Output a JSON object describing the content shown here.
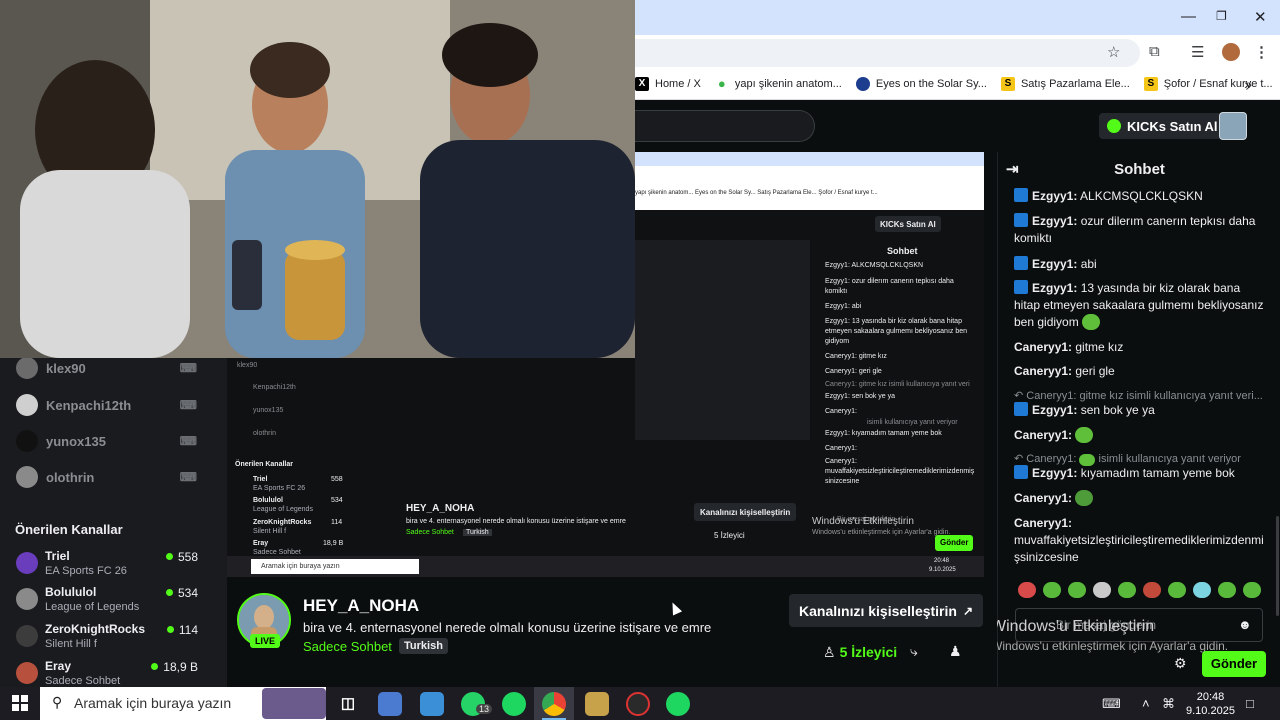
{
  "browser": {
    "bookmarks": [
      {
        "label": "Home / X",
        "icon": "x-icon",
        "color": "#000000"
      },
      {
        "label": "yapı şikenin anatom...",
        "icon": "leaf-icon",
        "color": "#3bb44a"
      },
      {
        "label": "Eyes on the Solar Sy...",
        "icon": "nasa-icon",
        "color": "#1d3d8f"
      },
      {
        "label": "Satış Pazarlama Ele...",
        "icon": "s-icon",
        "color": "#f5c518"
      },
      {
        "label": "Şofor / Esnaf kurye t...",
        "icon": "s-icon",
        "color": "#f5c518"
      }
    ],
    "more_chevron": "»"
  },
  "kick": {
    "kicks_button": "KICKs Satın Al",
    "accent": "#53fc18"
  },
  "sidebar": {
    "followed": [
      {
        "name": "klex90"
      },
      {
        "name": "Kenpachi12th"
      },
      {
        "name": "yunox135"
      },
      {
        "name": "olothrin"
      }
    ],
    "recommended_title": "Önerilen Kanallar",
    "recommended": [
      {
        "name": "Triel",
        "category": "EA Sports FC 26",
        "viewers": "558",
        "color": "#6a3dbd"
      },
      {
        "name": "Bolululol",
        "category": "League of Legends",
        "viewers": "534",
        "color": "#8a8a8a"
      },
      {
        "name": "ZeroKnightRocks",
        "category": "Silent Hill f",
        "viewers": "114",
        "color": "#3c3c3c"
      },
      {
        "name": "Eray",
        "category": "Sadece Sohbet",
        "viewers": "18,9 B",
        "color": "#b7503c"
      }
    ]
  },
  "stream": {
    "streamer": "HEY_A_NOHA",
    "live_label": "LIVE",
    "title": "bira ve 4. enternasyonel nerede olmalı konusu üzerine istişare ve emre",
    "category": "Sadece Sohbet",
    "tag": "Turkish",
    "customize_button": "Kanalınızı kişiselleştirin",
    "viewers": "5 İzleyici"
  },
  "chat": {
    "title": "Sohbet",
    "messages": [
      {
        "user": "Ezgyy1:",
        "text": " ALKCMSQLCKLQSKN"
      },
      {
        "user": "Ezgyy1:",
        "text": " ozur dilerım canerın tepkısı daha komiktı"
      },
      {
        "user": "Ezgyy1:",
        "text": " abi"
      },
      {
        "user": "Ezgyy1:",
        "text": " 13 yasında bir kiz olarak bana hitap etmeyen sakaalara gulmemı bekliyosanız ben gidiyom"
      },
      {
        "user": "Caneryy1:",
        "text": " gitme kız"
      },
      {
        "user": "Caneryy1:",
        "text": " geri gle"
      },
      {
        "user": "Ezgyy1:",
        "text": " sen bok ye ya"
      },
      {
        "user": "Caneryy1:",
        "text": ""
      },
      {
        "user": "Ezgyy1:",
        "text": " kıyamadım tamam yeme bok"
      },
      {
        "user": "Caneryy1:",
        "text": ""
      },
      {
        "user": "Caneryy1:",
        "text": " muvaffakiyetsizleştiricileştiremediklerimizdenmişsinizcesine"
      }
    ],
    "reply1": "Caneryy1: gitme kız isimli kullanıcıya yanıt veri...",
    "reply2": "isimli kullanıcıya yanıt veriyor",
    "input_placeholder": "Bir mesaj gönderin",
    "send_button": "Gönder",
    "windows_activate": "Windows'u Etkinleştirin",
    "windows_activate_sub": "Windows'u etkinleştirmek için Ayarlar'a gidin."
  },
  "nested": {
    "bookmarks": "yapı şikenin anatom...   Eyes on the Solar Sy...   Satış Pazarlama Ele...   Şofor / Esnaf kurye t...",
    "kicks_button": "KICKs Satın Al",
    "chat_title": "Sohbet",
    "chat_lines": [
      "Ezgyy1: ALKCMSQLCKLQSKN",
      "Ezgyy1: ozur dilerım canerın tepkısı daha",
      "komiktı",
      "Ezgyy1: abi",
      "Ezgyy1: 13 yasında bir kiz olarak bana hitap",
      "etmeyen sakaalara gulmemı bekliyosanız ben",
      "gidiyom",
      "Caneryy1: gitme kız",
      "Caneryy1: geri gle",
      "Caneryy1: gitme kız isimli kullanıcıya yanıt veri",
      "Ezgyy1: sen bok ye ya",
      "Caneryy1:",
      "isimli kullanıcıya yanıt veriyor",
      "Ezgyy1: kıyamadım tamam yeme bok",
      "Caneryy1:",
      "Caneryy1:",
      "muvaffakiyetsizleştiricileştiremediklerimizdenmiş",
      "sinizcesine"
    ],
    "followed": [
      "klex90",
      "Kenpachi12th",
      "yunox135",
      "olothrin"
    ],
    "recommended_title": "Önerilen Kanallar",
    "recommended": [
      {
        "name": "Triel",
        "category": "EA Sports FC 26",
        "viewers": "558"
      },
      {
        "name": "Bolululol",
        "category": "League of Legends",
        "viewers": "534"
      },
      {
        "name": "ZeroKnightRocks",
        "category": "Silent Hill f",
        "viewers": "114"
      },
      {
        "name": "Eray",
        "category": "Sadece Sohbet",
        "viewers": "18,9 B"
      }
    ],
    "streamer": "HEY_A_NOHA",
    "title": "bira ve 4. enternasyonel nerede olmalı konusu üzerine istişare ve emre",
    "category": "Sadece Sohbet",
    "tag": "Turkish",
    "customize_button": "Kanalınızı kişiselleştirin",
    "viewers": "5 İzleyici",
    "input_placeholder": "Bir mesaj gönderin",
    "send_button": "Gönder",
    "windows_activate": "Windows'u Etkinleştirin",
    "windows_activate_sub": "Windows'u etkinleştirmek için Ayarlar'a gidin.",
    "taskbar_search": "Aramak için buraya yazın",
    "clock_time": "20:48",
    "clock_date": "9.10.2025"
  },
  "taskbar": {
    "search_placeholder": "Aramak için buraya yazın",
    "whatsapp_badge": "13",
    "time": "20:48",
    "date": "9.10.2025"
  }
}
